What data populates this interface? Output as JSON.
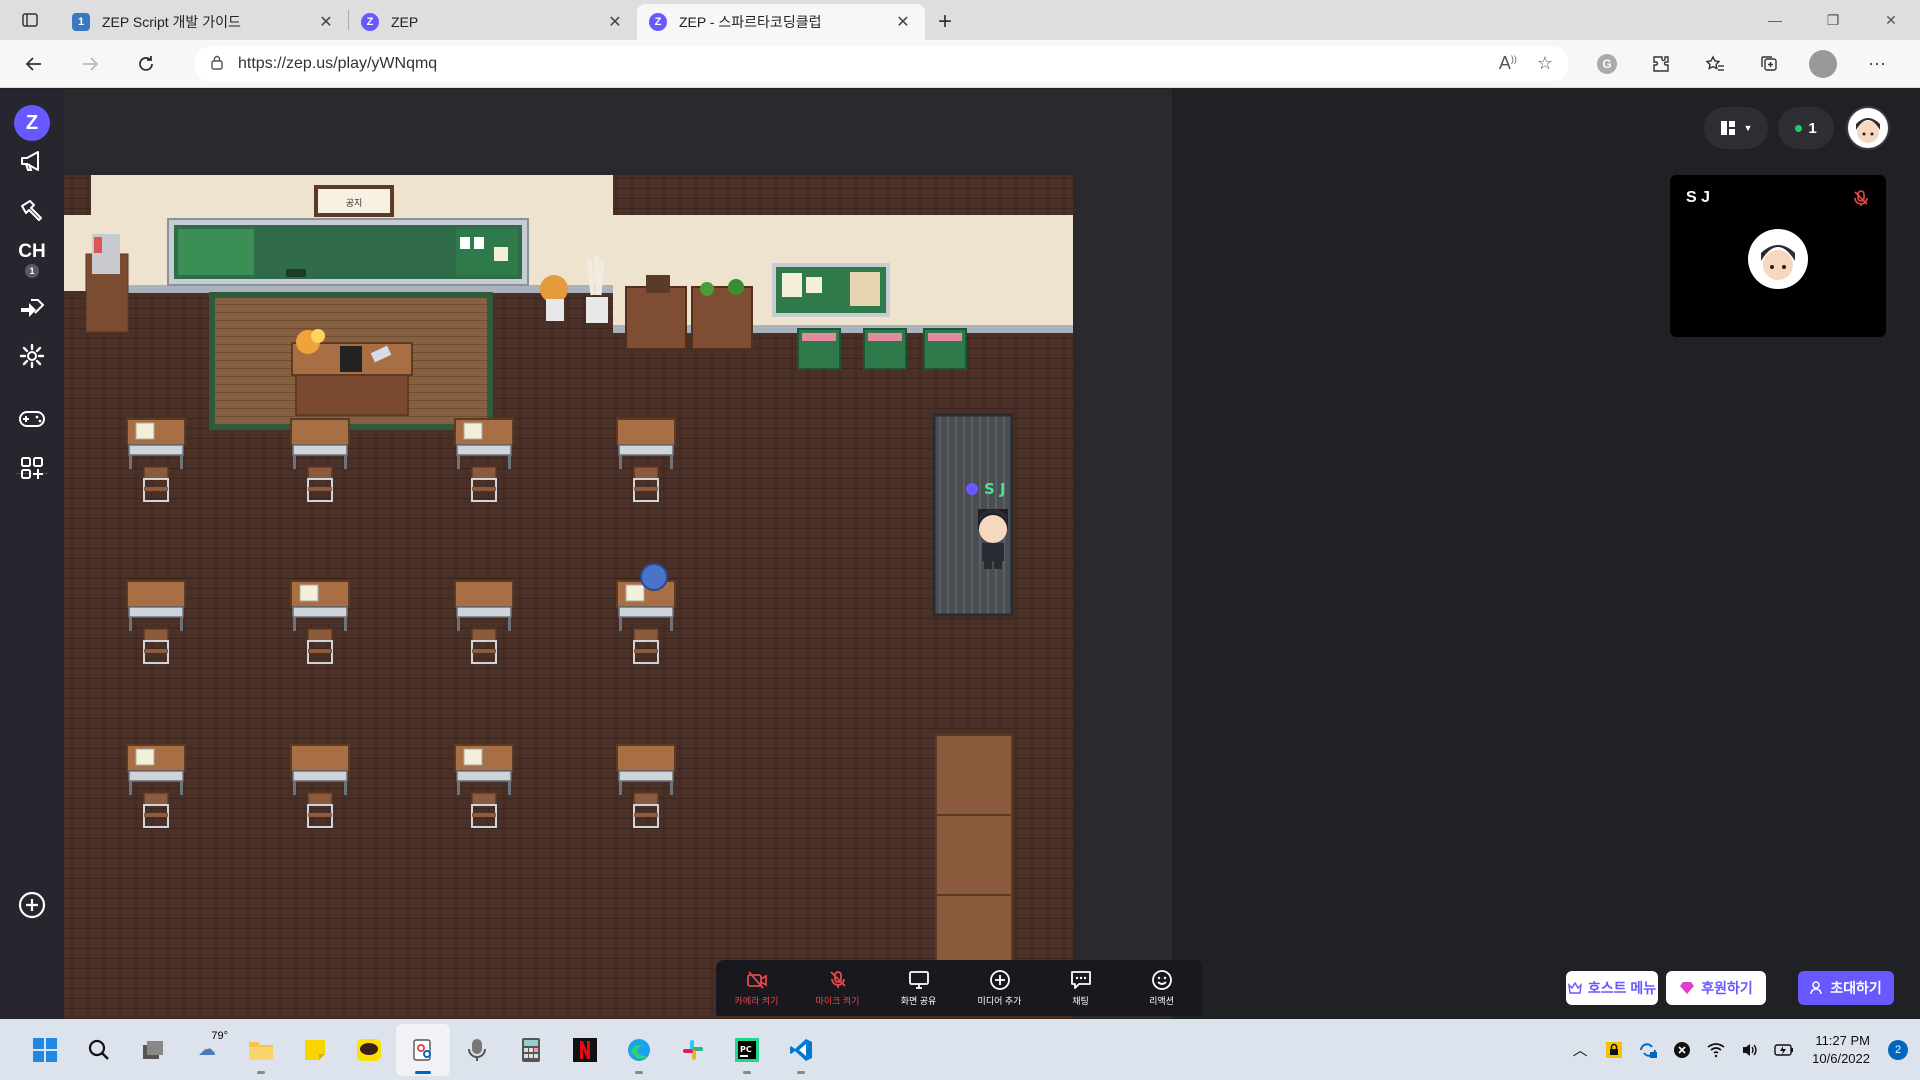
{
  "browser": {
    "tabs": [
      {
        "title": "ZEP Script 개발 가이드",
        "favicon_text": "1",
        "favicon_color": "#3b78c4",
        "active": false
      },
      {
        "title": "ZEP",
        "favicon_text": "Z",
        "favicon_color": "#6758ff",
        "active": false
      },
      {
        "title": "ZEP - 스파르타코딩클럽",
        "favicon_text": "Z",
        "favicon_color": "#6758ff",
        "active": true
      }
    ],
    "url": "https://zep.us/play/yWNqmq"
  },
  "zep": {
    "sidebar": {
      "channel_label": "CH",
      "channel_number": "1"
    },
    "map": {
      "player_name": "S J",
      "notice_sign": "공지"
    },
    "online_count": "1",
    "video_card": {
      "name": "S J"
    },
    "toolbar": [
      {
        "label": "카메라 켜기",
        "icon": "camera-off-icon",
        "off": true
      },
      {
        "label": "마이크 켜기",
        "icon": "mic-off-icon",
        "off": true
      },
      {
        "label": "화면 공유",
        "icon": "monitor-icon",
        "off": false
      },
      {
        "label": "미디어 추가",
        "icon": "plus-circle-icon",
        "off": false
      },
      {
        "label": "채팅",
        "icon": "chat-icon",
        "off": false
      },
      {
        "label": "리액션",
        "icon": "smile-icon",
        "off": false
      }
    ],
    "buttons": {
      "host_menu": "호스트 메뉴",
      "support": "후원하기",
      "invite": "초대하기"
    },
    "accent_color": "#6758ff"
  },
  "taskbar": {
    "weather": "79°",
    "time": "11:27 PM",
    "date": "10/6/2022",
    "notification_count": "2"
  }
}
